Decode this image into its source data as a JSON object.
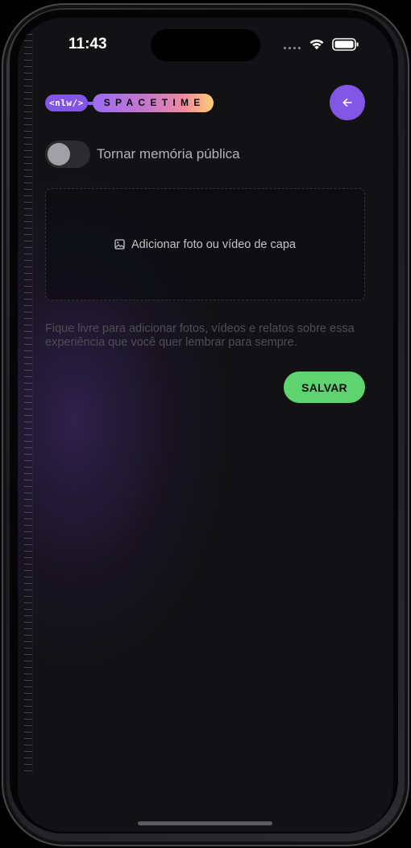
{
  "status_bar": {
    "time": "11:43",
    "wifi_icon": "wifi-icon",
    "battery_icon": "battery-icon"
  },
  "header": {
    "logo_prefix": "<nlw/>",
    "logo_name": "SPACETIME",
    "back_icon": "arrow-left-icon"
  },
  "form": {
    "public_toggle": {
      "label": "Tornar memória pública",
      "checked": false
    },
    "cover_upload": {
      "label": "Adicionar foto ou vídeo de capa",
      "icon": "image-icon"
    },
    "content": {
      "placeholder": "Fique livre para adicionar fotos, vídeos e relatos sobre essa experiência que você quer lembrar para sempre."
    },
    "save_label": "SALVAR"
  },
  "colors": {
    "accent_purple": "#8257e5",
    "save_green": "#5fd36f",
    "background": "#121215"
  }
}
